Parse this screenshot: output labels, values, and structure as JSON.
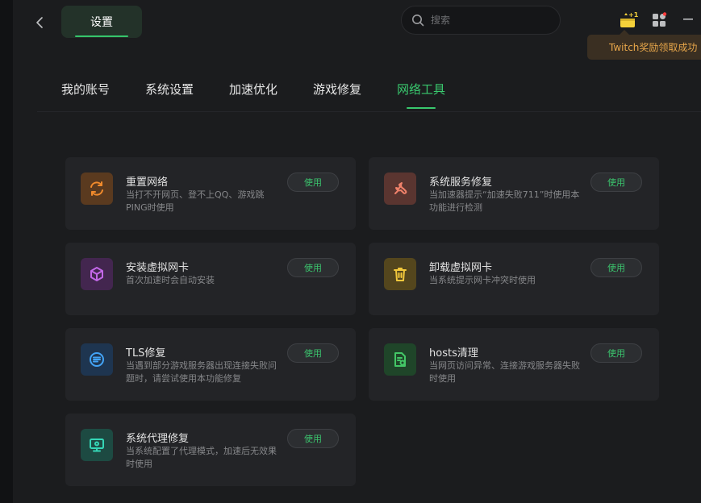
{
  "header": {
    "title": "设置",
    "search_placeholder": "搜索",
    "toast": "Twitch奖励领取成功"
  },
  "nav": {
    "tabs": [
      {
        "label": "我的账号"
      },
      {
        "label": "系统设置"
      },
      {
        "label": "加速优化"
      },
      {
        "label": "游戏修复"
      },
      {
        "label": "网络工具"
      }
    ],
    "active": "网络工具"
  },
  "tools": [
    {
      "title": "重置网络",
      "desc": "当打不开网页、登不上QQ、游戏跳PING时使用",
      "button": "使用",
      "icon": "refresh-icon",
      "color": "#f08a2c"
    },
    {
      "title": "系统服务修复",
      "desc": "当加速器提示“加速失败711”时使用本功能进行检测",
      "button": "使用",
      "icon": "wrench-icon",
      "color": "#f0816a"
    },
    {
      "title": "安装虚拟网卡",
      "desc": "首次加速时会自动安装",
      "button": "使用",
      "icon": "cube-icon",
      "color": "#c368e8"
    },
    {
      "title": "卸载虚拟网卡",
      "desc": "当系统提示网卡冲突时使用",
      "button": "使用",
      "icon": "trash-icon",
      "color": "#f2c83c"
    },
    {
      "title": "TLS修复",
      "desc": "当遇到部分游戏服务器出现连接失败问题时，请尝试使用本功能修复",
      "button": "使用",
      "icon": "server-icon",
      "color": "#43a3f5"
    },
    {
      "title": "hosts清理",
      "desc": "当网页访问异常、连接游戏服务器失败时使用",
      "button": "使用",
      "icon": "document-icon",
      "color": "#43c766"
    },
    {
      "title": "系统代理修复",
      "desc": "当系统配置了代理模式，加速后无效果时使用",
      "button": "使用",
      "icon": "monitor-icon",
      "color": "#35d6b6"
    }
  ]
}
